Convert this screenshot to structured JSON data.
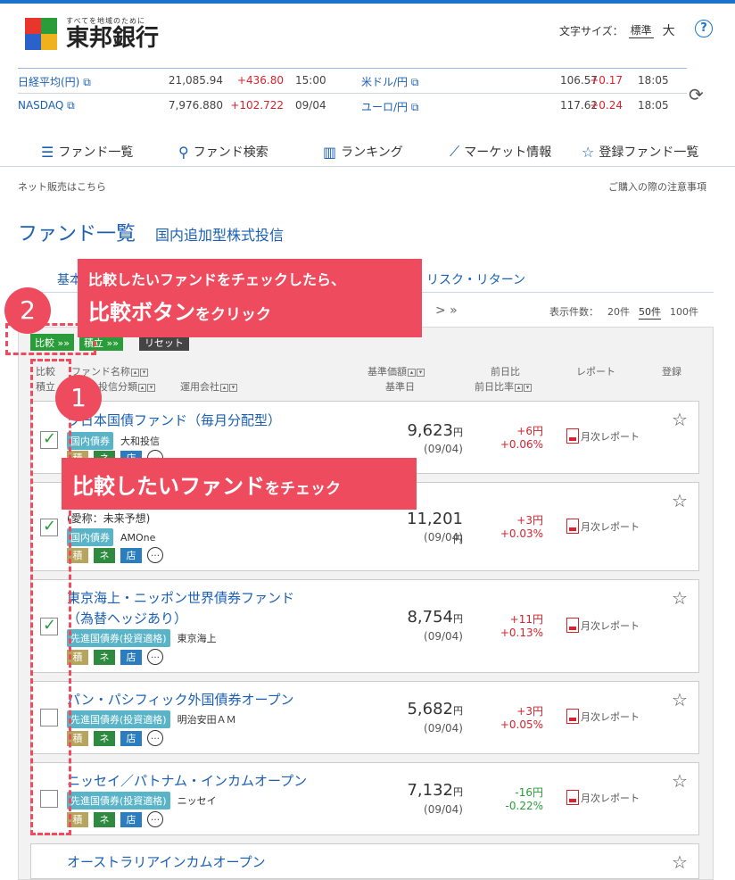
{
  "header": {
    "logo_sub": "すべてを地域のために",
    "logo_name": "東邦銀行",
    "fontsize_label": "文字サイズ：",
    "fontsize_std": "標準",
    "fontsize_big": "大",
    "help": "?"
  },
  "market": {
    "left": [
      {
        "name": "日経平均(円)",
        "value": "21,085.94",
        "change": "+436.80",
        "time": "15:00"
      },
      {
        "name": "NASDAQ",
        "value": "7,976.880",
        "change": "+102.722",
        "time": "09/04"
      }
    ],
    "right": [
      {
        "name": "米ドル/円",
        "value": "106.57",
        "change": "+0.17",
        "time": "18:05"
      },
      {
        "name": "ユーロ/円",
        "value": "117.62",
        "change": "+0.24",
        "time": "18:05"
      }
    ]
  },
  "nav": [
    "ファンド一覧",
    "ファンド検索",
    "ランキング",
    "マーケット情報",
    "登録ファンド一覧"
  ],
  "links": {
    "left": "ネット販売はこちら",
    "right": "ご購入の際の注意事項"
  },
  "page": {
    "title": "ファンド一覧",
    "subtitle": "国内追加型株式投信"
  },
  "tabs": [
    "基本",
    "リスク・リターン"
  ],
  "pager": {
    "arrows": "> »",
    "perpage_label": "表示件数：",
    "options": [
      "20件",
      "50件",
      "100件"
    ]
  },
  "buttons": {
    "compare": "比較 »»",
    "accumulate": "積立 »»",
    "reset": "リセット"
  },
  "headers": {
    "compare": "比較",
    "accumulate": "積立",
    "fund_name": "ファンド名称",
    "category": "投信分類",
    "company": "運用会社",
    "nav": "基準価額",
    "nav_date": "基準日",
    "diff": "前日比",
    "diff_rate": "前日比率",
    "report": "レポート",
    "register": "登録"
  },
  "badges": {
    "b1": "積",
    "b2": "ネ",
    "b3": "店",
    "chat": "…"
  },
  "funds": [
    {
      "name": "ワ日本国債ファンド（毎月分配型）",
      "name2": "",
      "category": "国内債券",
      "company": "大和投信",
      "price": "9,623",
      "unit": "円",
      "date": "(09/04)",
      "diff": "+6円",
      "rate": "+0.06%",
      "report": "月次レポート",
      "checked": true
    },
    {
      "name": "",
      "name2": "(愛称：未来予想)",
      "category": "国内債券",
      "company": "AMOne",
      "price": "11,201",
      "unit": "円",
      "date": "(09/04)",
      "diff": "+3円",
      "rate": "+0.03%",
      "report": "月次レポート",
      "checked": true
    },
    {
      "name": "東京海上・ニッポン世界債券ファンド",
      "name2": "（為替ヘッジあり）",
      "category": "先進国債券(投資適格)",
      "company": "東京海上",
      "price": "8,754",
      "unit": "円",
      "date": "(09/04)",
      "diff": "+11円",
      "rate": "+0.13%",
      "report": "月次レポート",
      "checked": true
    },
    {
      "name": "パン・パシフィック外国債券オープン",
      "name2": "",
      "category": "先進国債券(投資適格)",
      "company": "明治安田ＡＭ",
      "price": "5,682",
      "unit": "円",
      "date": "(09/04)",
      "diff": "+3円",
      "rate": "+0.05%",
      "report": "月次レポート",
      "checked": false
    },
    {
      "name": "ニッセイ／パトナム・インカムオープン",
      "name2": "",
      "category": "先進国債券(投資適格)",
      "company": "ニッセイ",
      "price": "7,132",
      "unit": "円",
      "date": "(09/04)",
      "diff": "-16円",
      "rate": "-0.22%",
      "report": "月次レポート",
      "checked": false
    },
    {
      "name": "オーストラリアインカムオープン",
      "name2": "",
      "category": "",
      "company": "",
      "price": "",
      "unit": "",
      "date": "",
      "diff": "",
      "rate": "",
      "report": "",
      "checked": false
    }
  ],
  "callouts": {
    "step2_line1": "比較したいファンドをチェックしたら、",
    "step2_big": "比較ボタン",
    "step2_small": "をクリック",
    "step1_big": "比較したいファンド",
    "step1_small": "をチェック",
    "num1": "1",
    "num2": "2"
  },
  "colors": {
    "accent": "#1a5fb4",
    "callout": "#ef4b5e",
    "up": "#d6232d",
    "down": "#2a9d3a"
  }
}
